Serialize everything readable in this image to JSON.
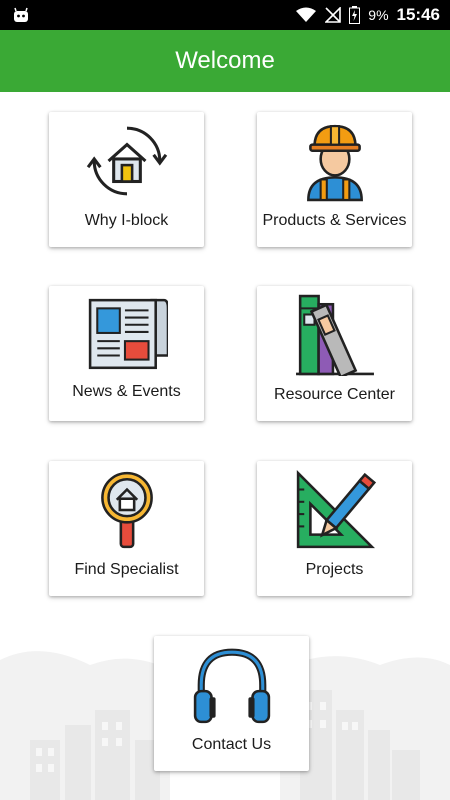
{
  "status_bar": {
    "battery_percent": "9%",
    "time": "15:46",
    "icons": [
      "android-icon",
      "wifi-icon",
      "no-signal-icon",
      "battery-charging-icon"
    ]
  },
  "app_bar": {
    "title": "Welcome"
  },
  "tiles": [
    {
      "label": "Why I-block",
      "icon": "house-cycle-icon"
    },
    {
      "label": "Products & Services",
      "icon": "worker-icon"
    },
    {
      "label": "News & Events",
      "icon": "newspaper-icon"
    },
    {
      "label": "Resource Center",
      "icon": "books-icon"
    },
    {
      "label": "Find Specialist",
      "icon": "magnifier-house-icon"
    },
    {
      "label": "Projects",
      "icon": "ruler-pencil-icon"
    },
    {
      "label": "Contact Us",
      "icon": "headphones-icon"
    }
  ],
  "colors": {
    "accent": "#3aa935",
    "status_bar": "#000000",
    "background": "#ffffff"
  }
}
